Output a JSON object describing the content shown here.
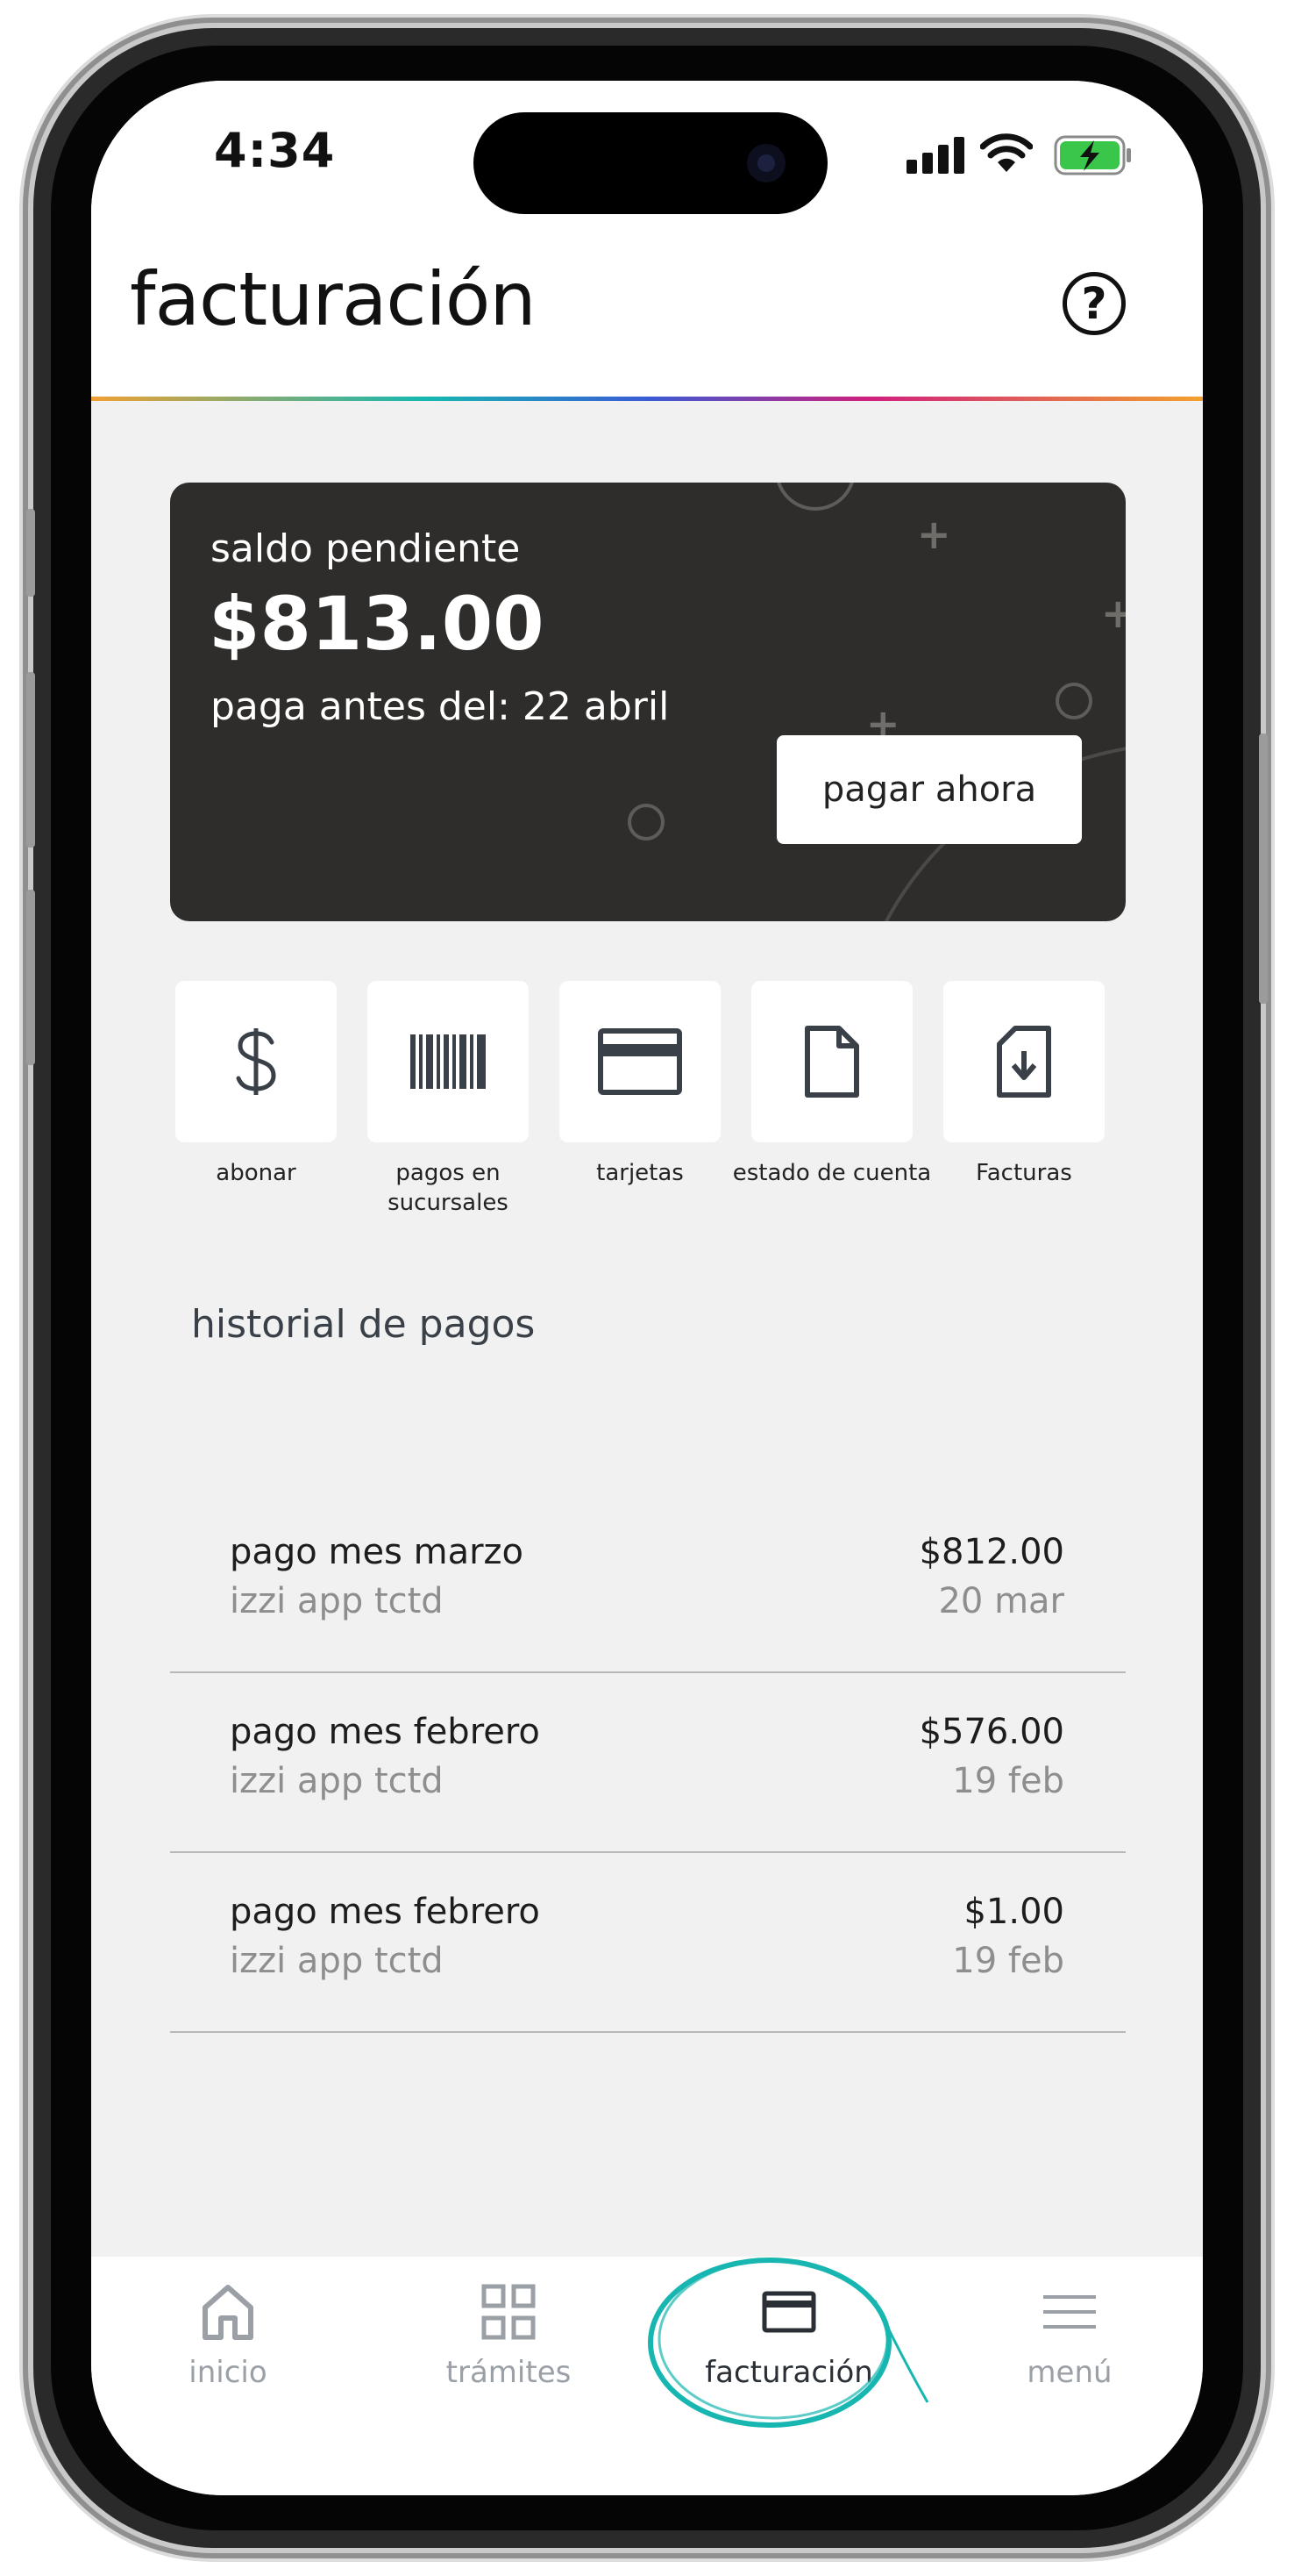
{
  "status_bar": {
    "time": "4:34"
  },
  "header": {
    "title": "facturación",
    "help_icon": "question-circle-icon",
    "help_glyph": "?"
  },
  "balance_card": {
    "label": "saldo pendiente",
    "amount": "$813.00",
    "due_text": "paga antes del: 22 abril",
    "pay_button": "pagar ahora",
    "plus_glyph": "+"
  },
  "quick_actions": [
    {
      "label": "abonar",
      "icon": "dollar-icon"
    },
    {
      "label": "pagos en sucursales",
      "icon": "barcode-icon"
    },
    {
      "label": "tarjetas",
      "icon": "credit-card-icon"
    },
    {
      "label": "estado de cuenta",
      "icon": "document-icon"
    },
    {
      "label": "Facturas",
      "icon": "invoice-download-icon"
    }
  ],
  "history": {
    "title": "historial de pagos",
    "items": [
      {
        "title": "pago mes marzo",
        "subtitle": "izzi app tctd",
        "amount": "$812.00",
        "date": "20 mar"
      },
      {
        "title": "pago mes febrero",
        "subtitle": "izzi app tctd",
        "amount": "$576.00",
        "date": "19 feb"
      },
      {
        "title": "pago mes febrero",
        "subtitle": "izzi app tctd",
        "amount": "$1.00",
        "date": "19 feb"
      }
    ]
  },
  "bottom_nav": {
    "active": "facturación",
    "items": [
      {
        "label": "inicio",
        "icon": "home-icon"
      },
      {
        "label": "trámites",
        "icon": "grid-icon"
      },
      {
        "label": "facturación",
        "icon": "card-icon"
      },
      {
        "label": "menú",
        "icon": "hamburger-menu-icon"
      }
    ]
  },
  "colors": {
    "card_background": "#2e2d2b",
    "screen_background": "#f0f1f0",
    "highlight_circle": "#18b6b0",
    "battery_green": "#3ac64a"
  }
}
